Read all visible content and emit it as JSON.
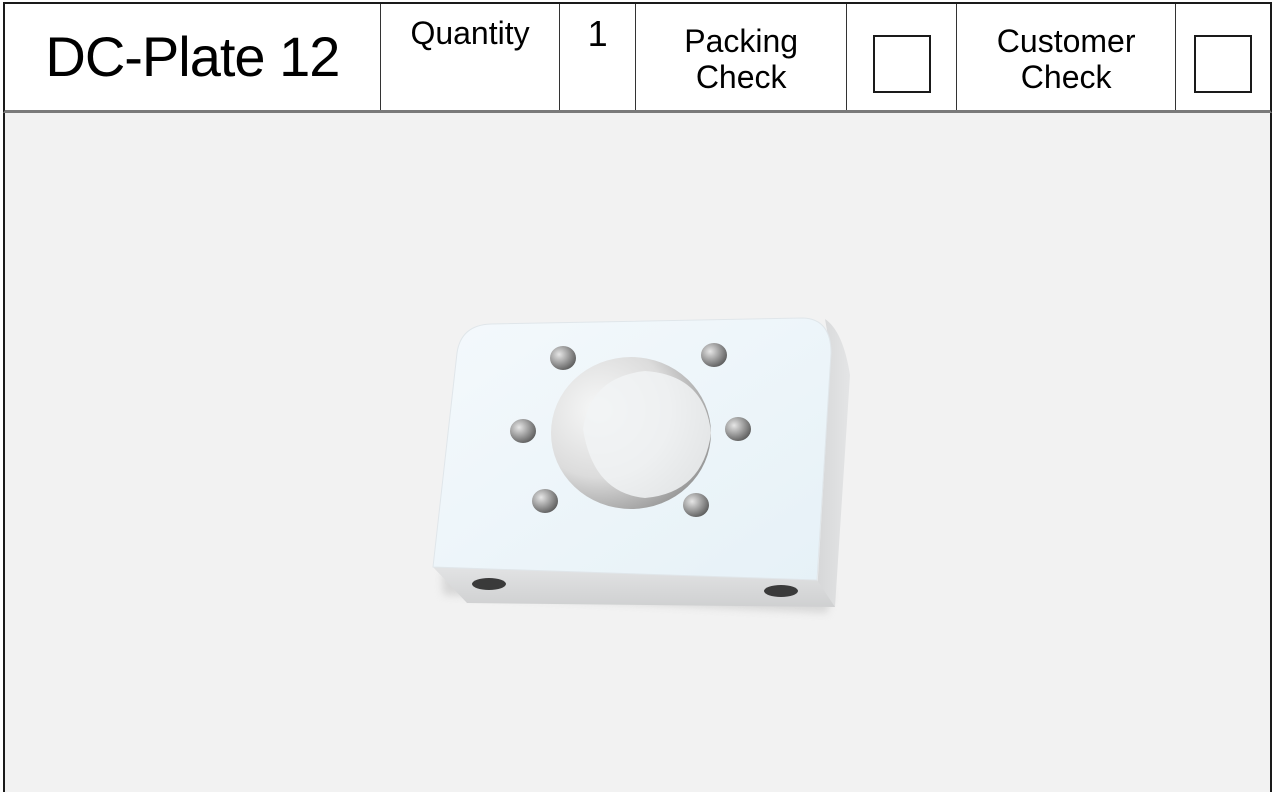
{
  "header": {
    "title": "DC-Plate 12",
    "quantity_label": "Quantity",
    "quantity_value": "1",
    "packing_check_line1": "Packing",
    "packing_check_line2": "Check",
    "packing_checked": false,
    "customer_check_line1": "Customer",
    "customer_check_line2": "Check",
    "customer_checked": false
  },
  "image": {
    "subject": "mounting-plate-render",
    "background_color": "#f2f2f2",
    "plate_face_color": "#eef6fb",
    "plate_side_color": "#d9dadb"
  }
}
